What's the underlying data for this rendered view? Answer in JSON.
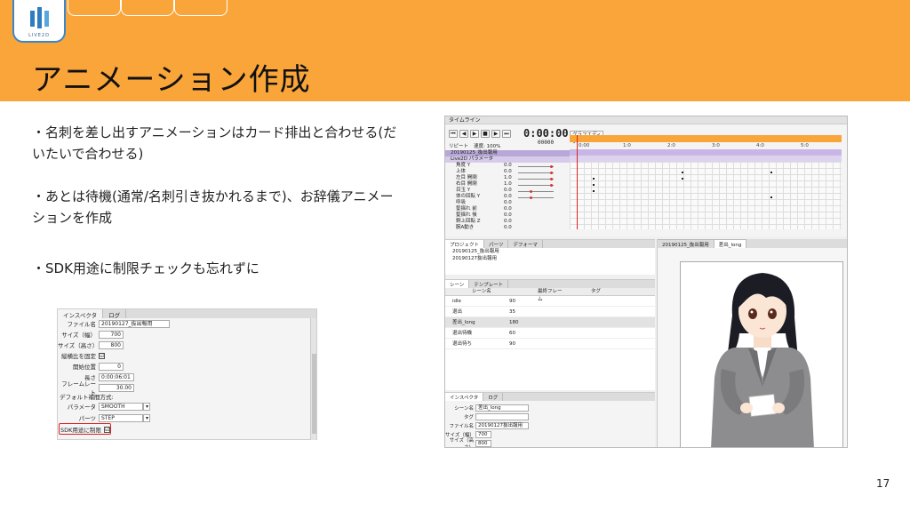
{
  "header": {
    "logo_text": "LIVE2D",
    "title": "アニメーション作成"
  },
  "bullets": [
    "・名刺を差し出すアニメーションはカード排出と合わせる(だいたいで合わせる)",
    "・あとは待機(通常/名刺引き抜かれるまで)、お辞儀アニメーションを作成",
    "・SDK用途に制限チェックも忘れずに"
  ],
  "inspector": {
    "tabs": [
      "インスペクタ",
      "ログ"
    ],
    "rows": [
      {
        "label": "ファイル名",
        "value": "20190127_抜出報用"
      },
      {
        "label": "サイズ（幅）",
        "value": "700"
      },
      {
        "label": "サイズ（高さ）",
        "value": "800"
      },
      {
        "label": "縦横比を固定",
        "value": "☑"
      },
      {
        "label": "開始位置",
        "value": "0"
      },
      {
        "label": "長さ",
        "value": "0:00:06:01"
      },
      {
        "label": "フレームレート",
        "value": "30.00"
      }
    ],
    "interp_label": "デフォルト補間方式:",
    "param_label": "パラメータ",
    "param_value": "SMOOTH",
    "parts_label": "パーツ",
    "parts_value": "STEP",
    "sdk_label": "SDK用途に制限",
    "sdk_checked": "☑"
  },
  "editor": {
    "timeline_title": "タイムライン",
    "timecode": "0:00:00",
    "framecode": "00000",
    "graph_label": "グラフエディタ",
    "repeat_label": "リピート",
    "speed_label": "速度: 100%",
    "ruler_labels": [
      "0:00",
      "1:0",
      "2:0",
      "3:0",
      "4:0",
      "5:0"
    ],
    "params": [
      {
        "name": "20190125_抜出報用",
        "value": ""
      },
      {
        "name": "Live2D パラメータ",
        "value": ""
      },
      {
        "name": "角度 Y",
        "value": "0.0"
      },
      {
        "name": "上体",
        "value": "0.0"
      },
      {
        "name": "左目 開閉",
        "value": "1.0"
      },
      {
        "name": "右目 開閉",
        "value": "1.0"
      },
      {
        "name": "目玉 Y",
        "value": "0.0"
      },
      {
        "name": "体の回転 Y",
        "value": "0.0"
      },
      {
        "name": "呼吸",
        "value": "0.0"
      },
      {
        "name": "髪揺れ 前",
        "value": "0.0"
      },
      {
        "name": "髪揺れ 後",
        "value": "0.0"
      },
      {
        "name": "銅上回転 Z",
        "value": "0.0"
      },
      {
        "name": "腕A動き",
        "value": "0.0"
      }
    ],
    "project_tabs": [
      "プロジェクト",
      "パーツ",
      "デフォーマ"
    ],
    "project_items": [
      "20190125_抜出報用",
      "20190127抜出報用"
    ],
    "scene_tabs": [
      "シーン",
      "テンプレート"
    ],
    "scene_headers": [
      "シーン名",
      "最終フレーム",
      "タグ"
    ],
    "scenes": [
      {
        "name": "idle",
        "frames": "90"
      },
      {
        "name": "退出",
        "frames": "35"
      },
      {
        "name": "差出_long",
        "frames": "180"
      },
      {
        "name": "退出待機",
        "frames": "60"
      },
      {
        "name": "退出待ち",
        "frames": "90"
      }
    ],
    "insp_tabs": [
      "インスペクタ",
      "ログ"
    ],
    "insp_rows": [
      {
        "label": "シーン名",
        "value": "差出_long"
      },
      {
        "label": "タグ",
        "value": ""
      },
      {
        "label": "ファイル名",
        "value": "20190127抜出報用"
      },
      {
        "label": "サイズ（幅）",
        "value": "700"
      },
      {
        "label": "サイズ（高さ）",
        "value": "800"
      }
    ],
    "viewer_tabs": [
      "20190125_抜出報用",
      "差出_long"
    ]
  },
  "page_number": "17",
  "colors": {
    "header": "#f9a53a",
    "accent_red": "#e02020",
    "timeline_band": "#c8b6e6"
  }
}
